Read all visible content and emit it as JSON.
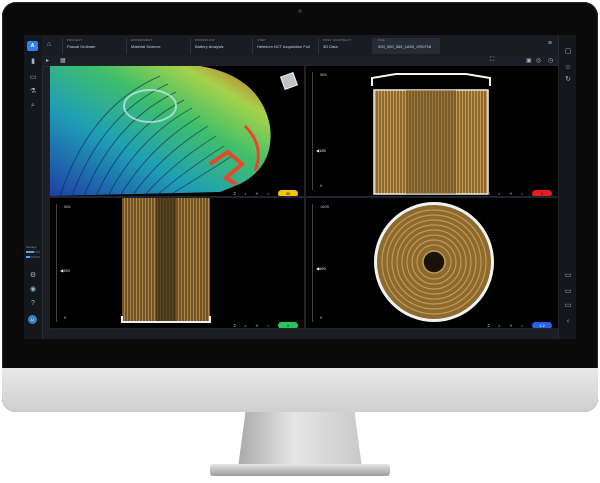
{
  "header": {
    "breadcrumbs": [
      {
        "key": "PROJECT",
        "value": "Pascal Ordinate"
      },
      {
        "key": "EXPERIMENT",
        "value": "Material Science"
      },
      {
        "key": "WORKFLOW",
        "value": "Battery Analysis"
      },
      {
        "key": "STEP",
        "value": "Helmium NCT Acquisition Full"
      },
      {
        "key": "PREV SNAPSHOT",
        "value": "3D Data"
      },
      {
        "key": "FILE",
        "value": "000_000_365_1A00_OR0716"
      }
    ]
  },
  "sidebar": {
    "storage_label": "Storage",
    "storage_bars": [
      0.55,
      0.3
    ],
    "avatar_initial": "U"
  },
  "viewports": [
    {
      "name": "3d-view",
      "pill": "30",
      "pill_color": "#f5c400"
    },
    {
      "name": "axial-top",
      "tick_top": "585",
      "marker": "195",
      "tick_bottom": "0",
      "pill": "1",
      "pill_color": "#e11d1d"
    },
    {
      "name": "coronal",
      "tick_top": "585",
      "marker": "253",
      "tick_bottom": "0",
      "pill": "1",
      "pill_color": "#22c55e"
    },
    {
      "name": "sagittal",
      "tick_top": "1605",
      "marker": "699",
      "tick_bottom": "0",
      "pill": "1 2",
      "pill_color": "#2563eb"
    }
  ],
  "colors": {
    "accent": "#2f80ed",
    "yellow_pill": "#f5c400",
    "red_pill": "#e11d1d",
    "green_pill": "#22c55e",
    "blue_pill": "#2563eb"
  }
}
